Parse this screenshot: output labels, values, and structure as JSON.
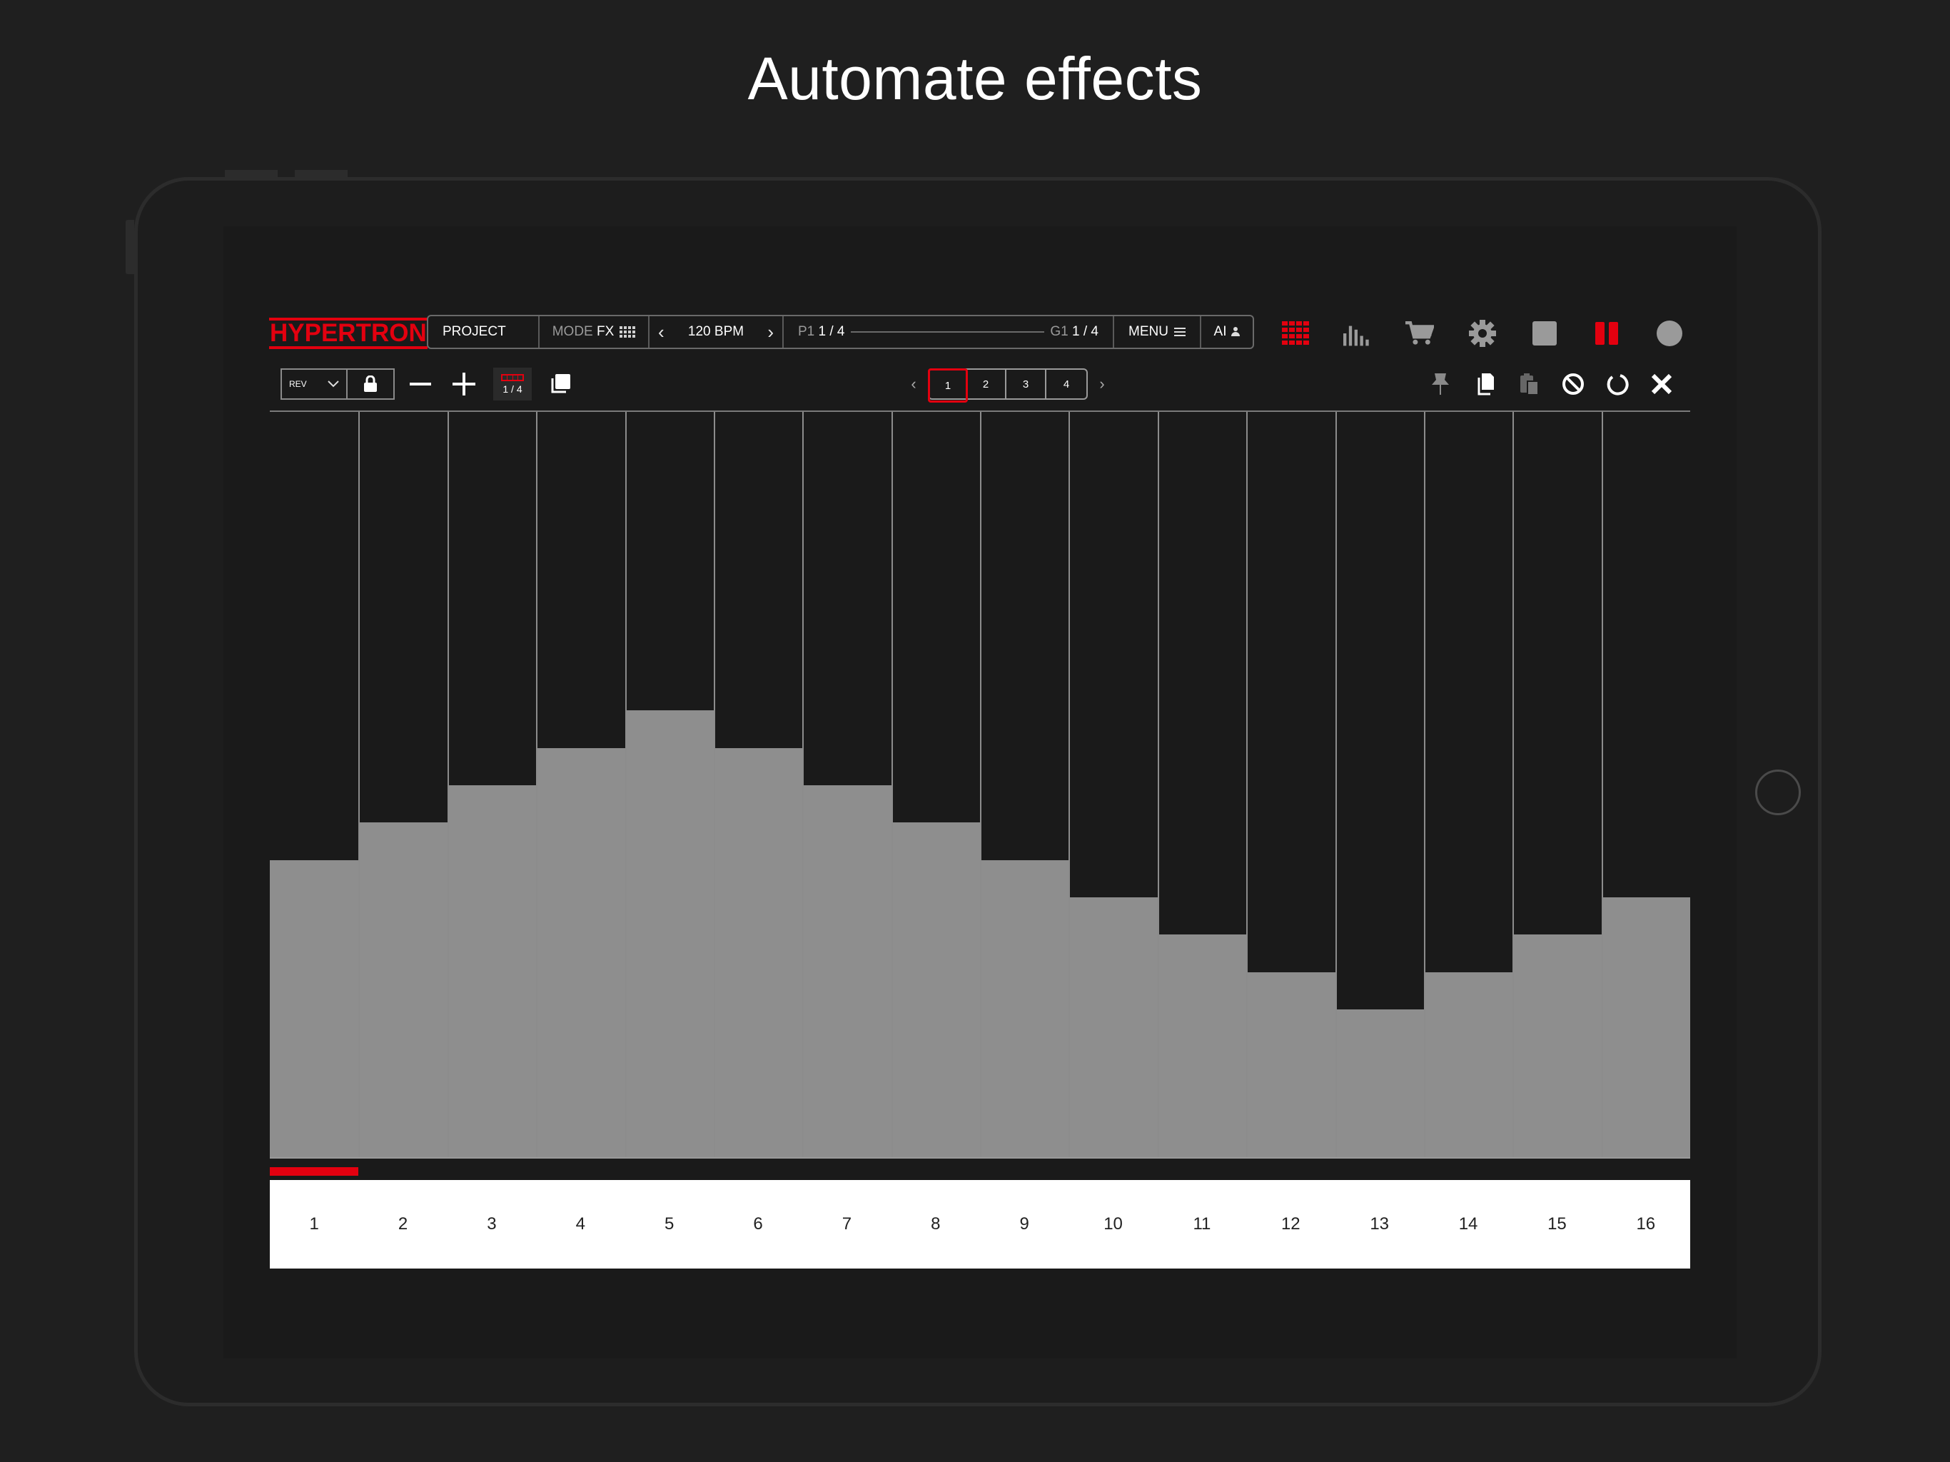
{
  "headline": "Automate effects",
  "app": {
    "logo": "HYPERTRON",
    "topbar": {
      "project": "PROJECT",
      "mode_label": "MODE",
      "mode_value": "FX",
      "bpm": "120 BPM",
      "pattern_label": "P1",
      "pattern_value": "1 / 4",
      "group_label": "G1",
      "group_value": "1 / 4",
      "menu": "MENU",
      "ai": "AI"
    },
    "top_icons": [
      "grid-icon",
      "mixer-bars-icon",
      "cart-icon",
      "gear-icon",
      "stop-icon",
      "pause-icon",
      "record-icon"
    ],
    "colors": {
      "accent": "#e3000f",
      "bar": "#8e8e8e",
      "background": "#1a1a1a"
    },
    "fx_select": "REV",
    "page_badge": "1 / 4",
    "pages": [
      "1",
      "2",
      "3",
      "4"
    ],
    "active_page": "1",
    "steps": [
      "1",
      "2",
      "3",
      "4",
      "5",
      "6",
      "7",
      "8",
      "9",
      "10",
      "11",
      "12",
      "13",
      "14",
      "15",
      "16"
    ],
    "step_values": [
      0.4,
      0.45,
      0.5,
      0.55,
      0.6,
      0.55,
      0.5,
      0.45,
      0.4,
      0.35,
      0.3,
      0.25,
      0.2,
      0.25,
      0.3,
      0.35
    ],
    "playhead_step": 1
  }
}
